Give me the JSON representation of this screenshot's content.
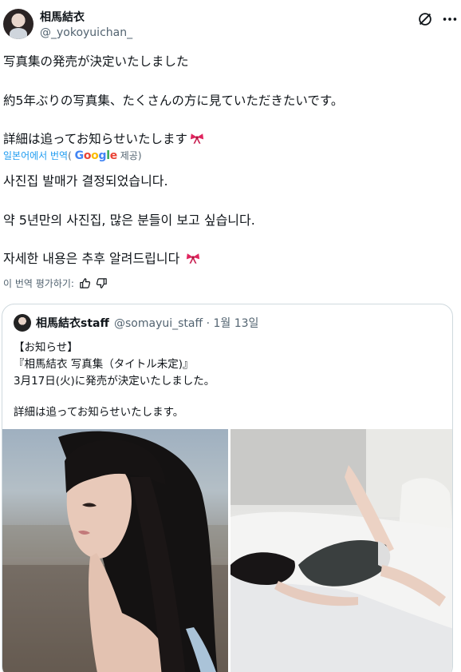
{
  "author": {
    "name": "相馬結衣",
    "handle": "@_yokoyuichan_"
  },
  "post": {
    "jp_line1": "写真集の発売が決定いたしました",
    "jp_line2": "約5年ぶりの写真集、たくさんの方に見ていただきたいです。",
    "jp_line3": "詳細は追ってお知らせいたします"
  },
  "translation": {
    "link_label": "일본어에서 번역",
    "paren_open": "(",
    "provider": "Google",
    "provider_suffix": "제공)",
    "kr_line1": "사진집 발매가 결정되었습니다.",
    "kr_line2": "약 5년만의 사진집, 많은 분들이 보고 싶습니다.",
    "kr_line3": "자세한 내용은 추후 알려드립니다",
    "rate_label": "이 번역 평가하기:"
  },
  "quote": {
    "name": "相馬結衣staff",
    "handle": "@somayui_staff · 1월 13일",
    "line1": "【お知らせ】",
    "line2": "『相馬結衣 写真集（タイトル未定)』",
    "line3": "3月17日(火)に発売が決定いたしました。",
    "line4": "詳細は追ってお知らせいたします。"
  },
  "colors": {
    "text": "#0f1419",
    "secondary": "#536471",
    "link": "#1d9bf0",
    "bow": "#e0245e"
  },
  "icons": {
    "grok": "grok-icon",
    "more": "more-icon",
    "bow": "ribbon-bow-icon",
    "thumbs_up": "thumbs-up-icon",
    "thumbs_down": "thumbs-down-icon"
  }
}
